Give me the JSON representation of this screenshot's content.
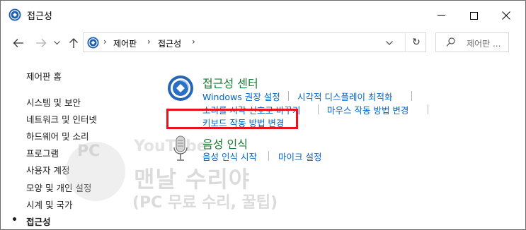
{
  "window": {
    "title": "접근성",
    "controls": {
      "minimize": "minimize",
      "maximize": "maximize",
      "close": "close"
    }
  },
  "navigation": {
    "back": "back",
    "forward": "forward",
    "recent": "recent",
    "up": "up",
    "breadcrumbs": [
      "제어판",
      "접근성"
    ],
    "search_placeholder": "제어판 ..."
  },
  "sidebar": {
    "home": "제어판 홈",
    "items": [
      {
        "label": "시스템 및 보안"
      },
      {
        "label": "네트워크 및 인터넷"
      },
      {
        "label": "하드웨어 및 소리"
      },
      {
        "label": "프로그램"
      },
      {
        "label": "사용자 계정"
      },
      {
        "label": "모양 및 개인 설정"
      },
      {
        "label": "시계 및 국가"
      },
      {
        "label": "접근성",
        "current": true
      }
    ]
  },
  "main": {
    "categories": [
      {
        "title": "접근성 센터",
        "links": [
          "Windows 권장 설정",
          "시각적 디스플레이 최적화",
          "소리를 시각 신호로 바꾸기",
          "마우스 작동 방법 변경",
          "키보드 작동 방법 변경"
        ]
      },
      {
        "title": "음성 인식",
        "links": [
          "음성 인식 시작",
          "마이크 설정"
        ]
      }
    ]
  },
  "watermark": {
    "main": "맨날 수리야",
    "sub": "(PC 무료 수리, 꿀팁)",
    "pc": "PC",
    "yt": "YouTube"
  },
  "colors": {
    "link": "#0066cc",
    "category_title": "#1e7a34",
    "highlight": "#e8121a"
  }
}
